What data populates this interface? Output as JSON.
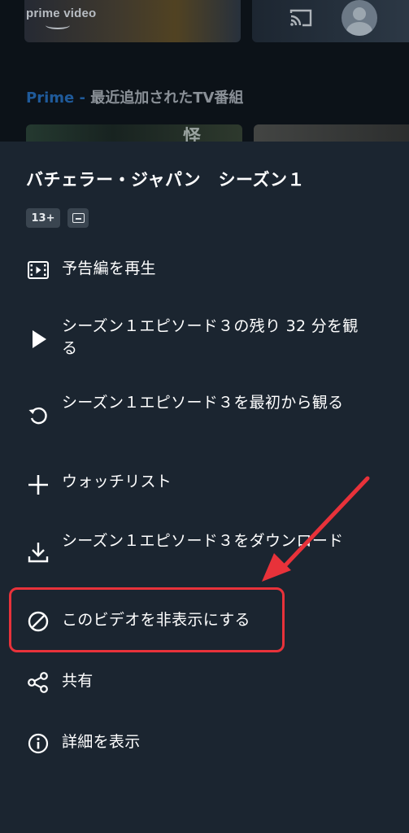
{
  "background": {
    "logo_text": "prime video",
    "row_title_prime": "Prime",
    "row_title_dash": " - ",
    "row_title_rest": "最近追加されたTV番組",
    "card_glyph": "怪"
  },
  "sheet": {
    "title": "バチェラー・ジャパン　シーズン１",
    "age_rating": "13+",
    "menu": [
      {
        "icon": "trailer-icon",
        "label": "予告編を再生"
      },
      {
        "icon": "play-icon",
        "label": "シーズン１エピソード３の残り 32 分を観る"
      },
      {
        "icon": "restart-icon",
        "label": "シーズン１エピソード３を最初から観る"
      },
      {
        "icon": "plus-icon",
        "label": "ウォッチリスト"
      },
      {
        "icon": "download-icon",
        "label": "シーズン１エピソード３をダウンロード"
      },
      {
        "icon": "hide-icon",
        "label": "このビデオを非表示にする"
      },
      {
        "icon": "share-icon",
        "label": "共有"
      },
      {
        "icon": "info-icon",
        "label": "詳細を表示"
      }
    ]
  },
  "annotation": {
    "color": "#e8323a"
  }
}
